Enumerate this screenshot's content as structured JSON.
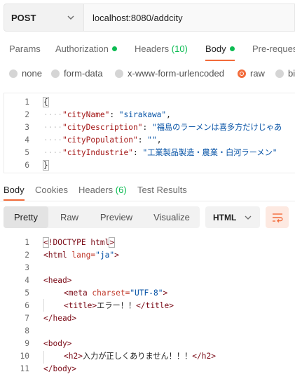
{
  "request": {
    "method": "POST",
    "url": "localhost:8080/addcity"
  },
  "request_tabs": {
    "params": "Params",
    "authorization": "Authorization",
    "headers": "Headers",
    "headers_count": "(10)",
    "body": "Body",
    "pre_request": "Pre-request"
  },
  "body_types": {
    "none": "none",
    "form_data": "form-data",
    "urlencoded": "x-www-form-urlencoded",
    "raw": "raw",
    "binary": "bi"
  },
  "request_body": {
    "line_numbers": [
      "1",
      "2",
      "3",
      "4",
      "5",
      "6"
    ],
    "open_brace": "{",
    "close_brace": "}",
    "city_name_key": "\"cityName\"",
    "city_name_value": "\"sirakawa\"",
    "city_description_key": "\"cityDescription\"",
    "city_description_value": "\"福島のラーメンは喜多方だけじゃあ",
    "city_population_key": "\"cityPopulation\"",
    "city_population_value": "\"\"",
    "city_industrie_key": "\"cityIndustrie\"",
    "city_industrie_value": "\"工業製品製造・農業・白河ラーメン\""
  },
  "response_tabs": {
    "body": "Body",
    "cookies": "Cookies",
    "headers": "Headers",
    "headers_count": "(6)",
    "test_results": "Test Results"
  },
  "response_toolbar": {
    "pretty": "Pretty",
    "raw": "Raw",
    "preview": "Preview",
    "visualize": "Visualize",
    "format": "HTML"
  },
  "response_body": {
    "line_numbers": [
      "1",
      "2",
      "3",
      "4",
      "5",
      "6",
      "7",
      "8",
      "9",
      "10",
      "11"
    ],
    "doctype_open": "<",
    "doctype_text": "!DOCTYPE html",
    "doctype_close": ">",
    "html_tag": "<html ",
    "html_attr": "lang=",
    "html_attr_value": "\"ja\"",
    "html_tag_close": ">",
    "head_open": "<head>",
    "meta_tag": "<meta ",
    "meta_attr": "charset=",
    "meta_attr_value": "\"UTF-8\"",
    "meta_close": ">",
    "title_open": "<title>",
    "title_text": "エラー！！",
    "title_close": "</title>",
    "head_close": "</head>",
    "body_open": "<body>",
    "h2_open": "<h2>",
    "h2_text": "入力が正しくありません！！！",
    "h2_close": "</h2>",
    "body_close": "</body>"
  },
  "colors": {
    "accent": "#f26b3a",
    "status_dot": "#0cbb52"
  }
}
